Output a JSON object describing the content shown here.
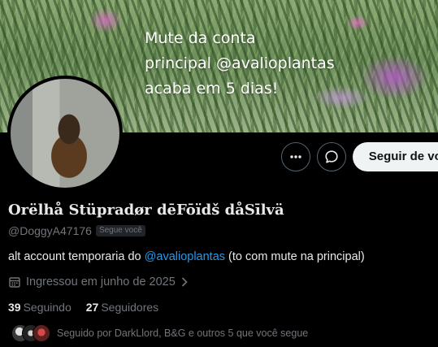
{
  "banner": {
    "text": "Mute da conta\nprincipal @avalioplantas\nacaba em 5 dias!"
  },
  "actions": {
    "follow_label": "Seguir de volta"
  },
  "profile": {
    "display_name": "Orëlhå Stüpradør dēFōïdš dåSīlvä",
    "handle": "@DoggyA47176",
    "follows_you_badge": "Segue você",
    "bio_prefix": "alt account temporaria do ",
    "bio_mention": "@avalioplantas",
    "bio_suffix": " (to com mute na principal)",
    "joined": "Ingressou em junho de 2025"
  },
  "stats": {
    "following_count": "39",
    "following_label": "Seguindo",
    "followers_count": "27",
    "followers_label": "Seguidores"
  },
  "followed_by": {
    "text": "Seguido por DarkLlord, B&G e outros 5 que você segue"
  },
  "colors": {
    "accent": "#1d9bf0",
    "secondary_text": "#71767b",
    "primary_text": "#e7e9ea",
    "background": "#000000"
  },
  "icons": [
    "more-icon",
    "message-icon",
    "calendar-icon",
    "chevron-right-icon"
  ]
}
